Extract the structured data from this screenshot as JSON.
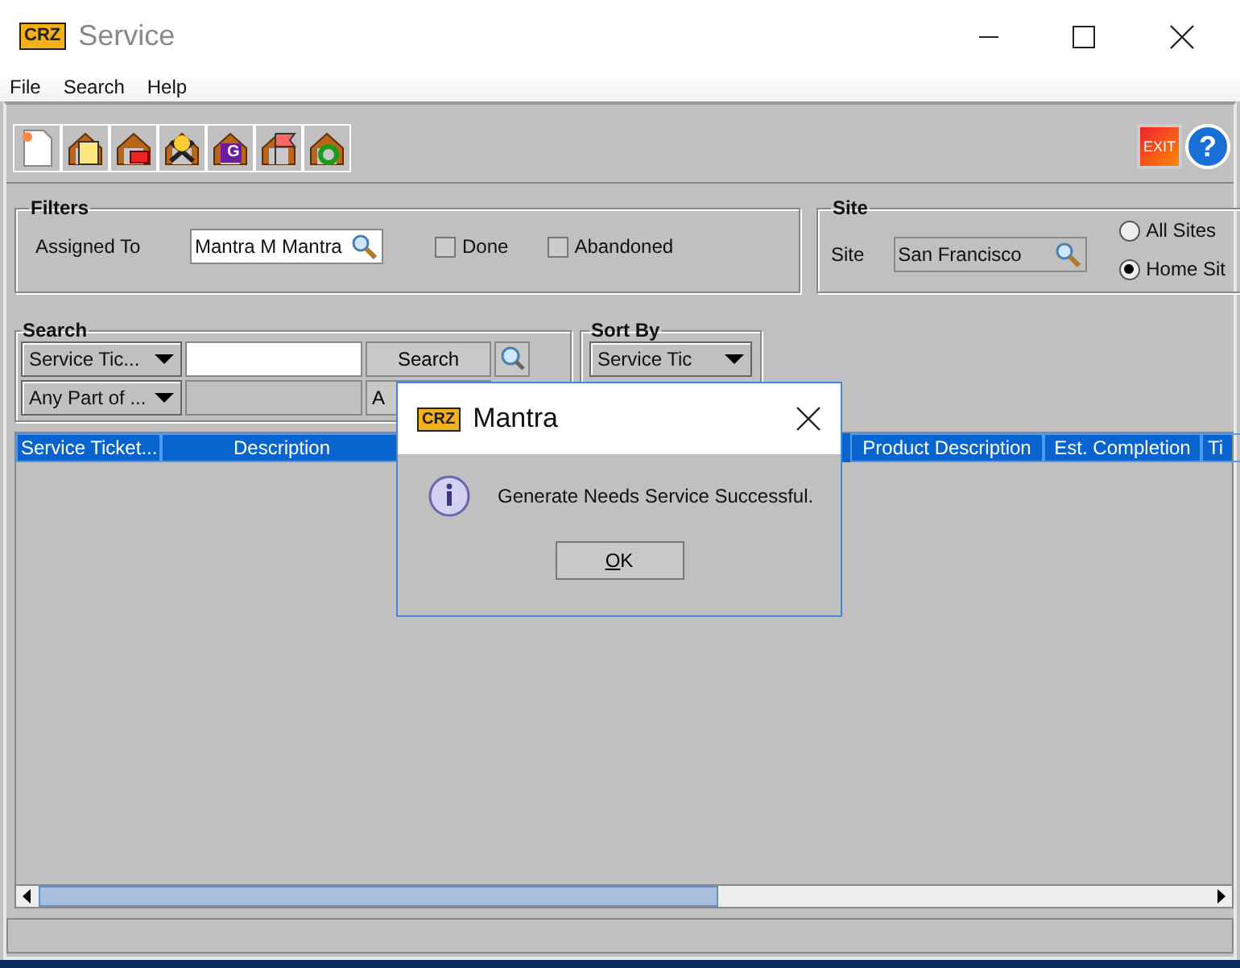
{
  "window": {
    "title": "Service",
    "logo": "CRZ"
  },
  "menu": [
    {
      "label": "File"
    },
    {
      "label": "Search"
    },
    {
      "label": "Help"
    }
  ],
  "toolbar": {
    "tools": [
      {
        "kind": "document"
      },
      {
        "kind": "clipboard"
      },
      {
        "kind": "box"
      },
      {
        "kind": "tools"
      },
      {
        "kind": "letter",
        "glyph": "G"
      },
      {
        "kind": "flag"
      },
      {
        "kind": "refresh"
      }
    ],
    "exit": "EXIT",
    "help": "?"
  },
  "filters": {
    "title": "Filters",
    "assigned_label": "Assigned To",
    "assigned_value": "Mantra M Mantra",
    "checkboxes": [
      {
        "label": "Done",
        "checked": false
      },
      {
        "label": "Abandoned",
        "checked": false
      }
    ]
  },
  "site": {
    "title": "Site",
    "label": "Site",
    "value": "San Francisco",
    "radios": [
      {
        "label": "All Sites",
        "selected": false
      },
      {
        "label": "Home Sit",
        "selected": true
      }
    ]
  },
  "search": {
    "title": "Search",
    "field_combo": "Service Tic...",
    "match_combo": "Any Part of ...",
    "buttons": [
      "Search",
      "A"
    ]
  },
  "sort_by": {
    "title": "Sort By",
    "combo": "Service Tic"
  },
  "table": {
    "columns": [
      "Service Ticket...",
      "Description",
      "Product Description",
      "Est. Completion",
      "Ti"
    ]
  },
  "dialog": {
    "title": "Mantra",
    "logo": "CRZ",
    "message": "Generate Needs Service Successful.",
    "button": "OK"
  }
}
